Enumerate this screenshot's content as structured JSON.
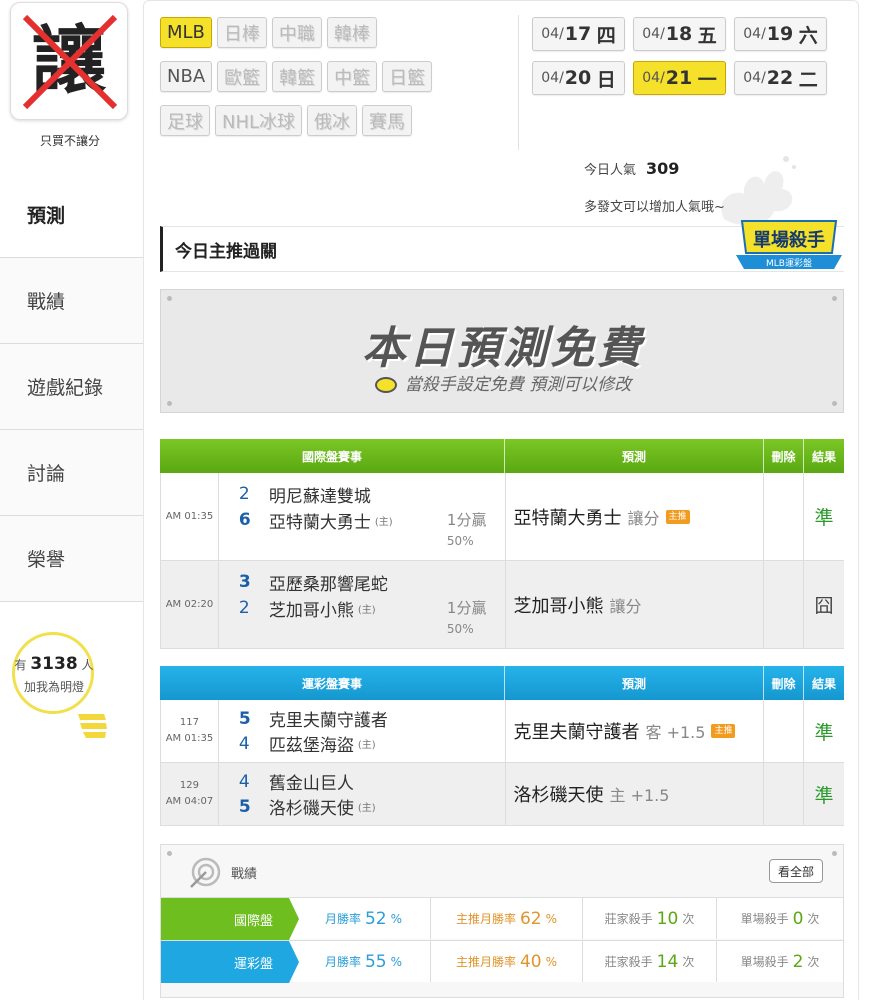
{
  "sidebar": {
    "avatar_char": "讓",
    "caption": "只買不讓分",
    "nav": [
      {
        "label": "預測",
        "active": true
      },
      {
        "label": "戰績",
        "active": false
      },
      {
        "label": "遊戲紀錄",
        "active": false
      },
      {
        "label": "討論",
        "active": false
      },
      {
        "label": "榮譽",
        "active": false
      }
    ],
    "fans_prefix": "有",
    "fans_count": "3138",
    "fans_suffix": "人",
    "fans_text": "加我為明燈"
  },
  "sports": {
    "row1": [
      "MLB",
      "日棒",
      "中職",
      "韓棒"
    ],
    "row2": [
      "NBA",
      "歐籃",
      "韓籃",
      "中籃",
      "日籃"
    ],
    "row3": [
      "足球",
      "NHL冰球",
      "俄冰",
      "賽馬"
    ],
    "active": "MLB"
  },
  "dates": {
    "row1": [
      {
        "md": "04/",
        "day": "17",
        "wd": "四"
      },
      {
        "md": "04/",
        "day": "18",
        "wd": "五"
      },
      {
        "md": "04/",
        "day": "19",
        "wd": "六"
      }
    ],
    "row2": [
      {
        "md": "04/",
        "day": "20",
        "wd": "日"
      },
      {
        "md": "04/",
        "day": "21",
        "wd": "一"
      },
      {
        "md": "04/",
        "day": "22",
        "wd": "二"
      }
    ],
    "active": "04/21"
  },
  "popularity": {
    "label": "今日人氣",
    "value": "309",
    "hint": "多發文可以增加人氣哦~"
  },
  "section_title": "今日主推過關",
  "killer_badge": {
    "line1": "單場殺手",
    "line2": "MLB運彩盤"
  },
  "free_banner": {
    "title": "本日預測免費",
    "subtitle": "當殺手設定免費 預測可以修改"
  },
  "intl_table": {
    "headers": {
      "game": "國際盤賽事",
      "pred": "預測",
      "del": "刪除",
      "res": "結果"
    },
    "rows": [
      {
        "no": "",
        "time": "AM 01:35",
        "away_score": "2",
        "away": "明尼蘇達雙城",
        "home_score": "6",
        "home": "亞特蘭大勇士",
        "home_mark": "(主)",
        "hc1": "1分贏",
        "hc2": "50",
        "hc2u": "%",
        "pred_team": "亞特蘭大勇士",
        "pred_type": "讓分",
        "tag": "主推",
        "result": "準"
      },
      {
        "no": "",
        "time": "AM 02:20",
        "away_score": "3",
        "away": "亞歷桑那響尾蛇",
        "home_score": "2",
        "home": "芝加哥小熊",
        "home_mark": "(主)",
        "hc1": "1分贏",
        "hc2": "50",
        "hc2u": "%",
        "pred_team": "芝加哥小熊",
        "pred_type": "讓分",
        "tag": "",
        "result": "囧"
      }
    ]
  },
  "sport_table": {
    "headers": {
      "game": "運彩盤賽事",
      "pred": "預測",
      "del": "刪除",
      "res": "結果"
    },
    "rows": [
      {
        "no": "117",
        "time": "AM 01:35",
        "away_score": "5",
        "away": "克里夫蘭守護者",
        "home_score": "4",
        "home": "匹茲堡海盜",
        "home_mark": "(主)",
        "pred_team": "克里夫蘭守護者",
        "pred_type": "客 +1.5",
        "tag": "主推",
        "result": "準"
      },
      {
        "no": "129",
        "time": "AM 04:07",
        "away_score": "4",
        "away": "舊金山巨人",
        "home_score": "5",
        "home": "洛杉磯天使",
        "home_mark": "(主)",
        "pred_team": "洛杉磯天使",
        "pred_type": "主 +1.5",
        "tag": "",
        "result": "準"
      }
    ]
  },
  "record": {
    "title": "戰績",
    "button": "看全部",
    "rows": [
      {
        "label": "國際盤",
        "c1_label": "月勝率",
        "c1_val": "52",
        "c1_unit": "%",
        "c2_label": "主推月勝率",
        "c2_val": "62",
        "c2_unit": "%",
        "c3_label": "莊家殺手",
        "c3_val": "10",
        "c3_unit": "次",
        "c4_label": "單場殺手",
        "c4_val": "0",
        "c4_unit": "次"
      },
      {
        "label": "運彩盤",
        "c1_label": "月勝率",
        "c1_val": "55",
        "c1_unit": "%",
        "c2_label": "主推月勝率",
        "c2_val": "40",
        "c2_unit": "%",
        "c3_label": "莊家殺手",
        "c3_val": "14",
        "c3_unit": "次",
        "c4_label": "單場殺手",
        "c4_val": "2",
        "c4_unit": "次"
      }
    ]
  },
  "colors": {
    "accent_yellow": "#f5e129",
    "intl_green": "#6dbe1e",
    "sport_blue": "#1ea7e0",
    "win_green": "#2a9a2a",
    "tag_orange": "#f29b1f"
  }
}
